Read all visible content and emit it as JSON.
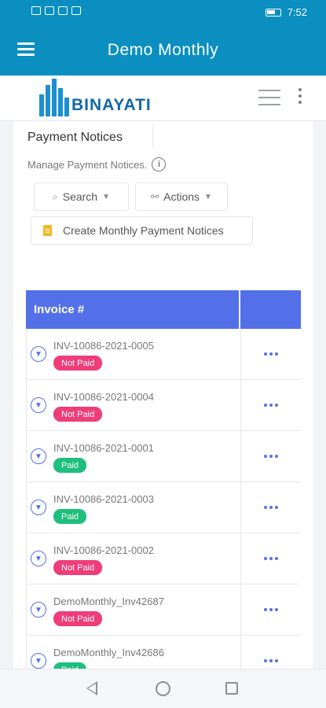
{
  "status_bar": {
    "time": "7:52"
  },
  "app_bar": {
    "title": "Demo Monthly"
  },
  "brand": {
    "logo_text": "BINAYATI"
  },
  "page": {
    "title": "Payment Notices",
    "subtitle": "Manage Payment Notices.",
    "search_label": "Search",
    "actions_label": "Actions",
    "create_label": "Create Monthly Payment Notices"
  },
  "table": {
    "header_invoice": "Invoice #",
    "rows": [
      {
        "invoice": "INV-10086-2021-0005",
        "status": "Not Paid"
      },
      {
        "invoice": "INV-10086-2021-0004",
        "status": "Not Paid"
      },
      {
        "invoice": "INV-10086-2021-0001",
        "status": "Paid"
      },
      {
        "invoice": "INV-10086-2021-0003",
        "status": "Paid"
      },
      {
        "invoice": "INV-10086-2021-0002",
        "status": "Not Paid"
      },
      {
        "invoice": "DemoMonthly_Inv42687",
        "status": "Not Paid"
      },
      {
        "invoice": "DemoMonthly_Inv42686",
        "status": "Paid"
      }
    ]
  },
  "colors": {
    "app_bar": "#0a8fc0",
    "table_header": "#5370e8",
    "not_paid": "#ee3d78",
    "paid": "#1ebf7d"
  },
  "icons": {
    "menu": "hamburger-icon",
    "info": "info-icon",
    "search": "search-icon",
    "actions": "link-icon",
    "create": "document-icon",
    "expand": "chevron-down-circle-icon",
    "more": "more-horizontal-icon"
  }
}
